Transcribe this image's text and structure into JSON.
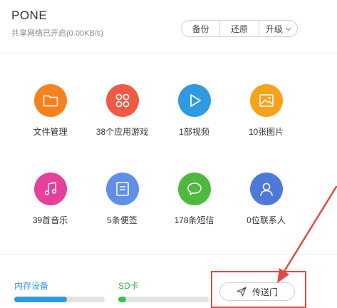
{
  "header": {
    "device_name": "PONE",
    "share_status": "共享网络已开启(0.00KB/s)",
    "buttons": [
      {
        "label": "备份"
      },
      {
        "label": "还原"
      },
      {
        "label": "升级"
      }
    ]
  },
  "categories": [
    {
      "label": "文件管理",
      "icon": "folder-icon",
      "color": "#f5821f"
    },
    {
      "label": "38个应用游戏",
      "icon": "apps-icon",
      "color": "#f05a44"
    },
    {
      "label": "1部视频",
      "icon": "play-icon",
      "color": "#2f9ae0"
    },
    {
      "label": "10张图片",
      "icon": "image-icon",
      "color": "#f7a21b"
    },
    {
      "label": "39首音乐",
      "icon": "music-icon",
      "color": "#e6409c"
    },
    {
      "label": "5条便签",
      "icon": "note-icon",
      "color": "#5f8fe6"
    },
    {
      "label": "178条短信",
      "icon": "message-icon",
      "color": "#4fb83f"
    },
    {
      "label": "0位联系人",
      "icon": "contact-icon",
      "color": "#4f79d9"
    }
  ],
  "storage": {
    "internal": {
      "label": "内存设备",
      "used_fraction": 0.58
    },
    "sd": {
      "label": "SD卡",
      "used_fraction": 0.09
    }
  },
  "transfer": {
    "label": "传送门",
    "icon": "send-icon"
  },
  "annotation": {
    "color": "#e04a45"
  }
}
